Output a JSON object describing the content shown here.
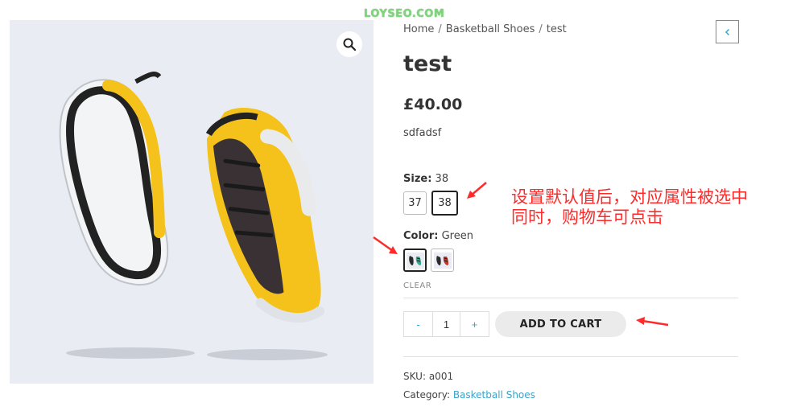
{
  "watermark": "LOYSEO.COM",
  "breadcrumb": {
    "home": "Home",
    "category": "Basketball Shoes",
    "current": "test",
    "separator": "/"
  },
  "product": {
    "title": "test",
    "price": "£40.00",
    "description": "sdfadsf"
  },
  "size": {
    "label": "Size:",
    "selected": "38",
    "options": [
      "37",
      "38"
    ]
  },
  "color": {
    "label": "Color:",
    "selected": "Green"
  },
  "clear_label": "CLEAR",
  "quantity": {
    "minus": "-",
    "value": "1",
    "plus": "+"
  },
  "add_to_cart_label": "ADD TO CART",
  "meta": {
    "sku_label": "SKU:",
    "sku": "a001",
    "category_label": "Category:",
    "category": "Basketball Shoes"
  },
  "annotation": {
    "line1": "设置默认值后，对应属性被选中",
    "line2": "同时，购物车可点击"
  },
  "colors": {
    "accent": "#3aa3c7",
    "annotation": "#ff2a2a"
  },
  "icons": {
    "zoom": "search-icon",
    "back": "chevron-left-icon"
  }
}
